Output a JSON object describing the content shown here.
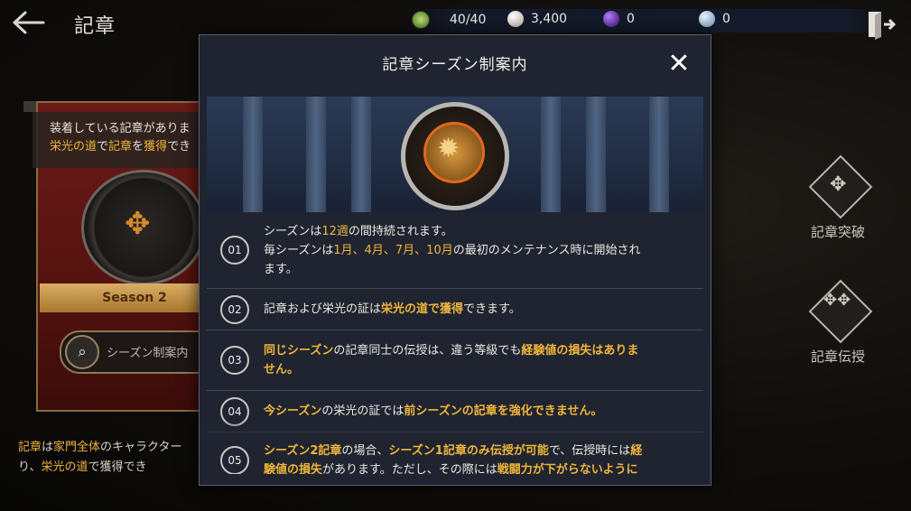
{
  "header": {
    "title": "記章"
  },
  "resources": [
    {
      "value": "40/40",
      "icon": "stamina-icon",
      "color": "#8fbf4a"
    },
    {
      "value": "3,400",
      "icon": "pearl-icon",
      "color": "#d8c9c0"
    },
    {
      "value": "0",
      "icon": "purple-gem-icon",
      "color": "#7a2fb8"
    },
    {
      "value": "0",
      "icon": "silver-coin-icon",
      "color": "#9fc4e8"
    }
  ],
  "left_panel": {
    "equip_text_1": "装着している記章がありま",
    "equip_text_2a": "栄光の道",
    "equip_text_2b": "で",
    "equip_text_2c": "記章",
    "equip_text_2d": "を",
    "equip_text_2e": "獲得",
    "equip_text_2f": "でき",
    "season_label": "Season 2",
    "season_guide_label": "シーズン制案内",
    "bottom_1a": "記章",
    "bottom_1b": "は",
    "bottom_1c": "家門全体",
    "bottom_1d": "のキャラクター",
    "bottom_2a": "り、",
    "bottom_2b": "栄光の道",
    "bottom_2c": "で獲得でき"
  },
  "right_buttons": {
    "breakthrough_label": "記章突破",
    "transfer_label": "記章伝授"
  },
  "modal": {
    "title": "記章シーズン制案内",
    "items": [
      {
        "num": "01",
        "l1a": "シーズンは",
        "l1b": "12週",
        "l1c": "の間持続されます。",
        "l2a": "毎シーズンは",
        "l2b": "1月、4月、7月、10月",
        "l2c": "の最初のメンテナンス時に開始され",
        "l3": "ます。"
      },
      {
        "num": "02",
        "a": "記章および栄光の証は",
        "b": "栄光の道で獲得",
        "c": "できます。"
      },
      {
        "num": "03",
        "a": "同じシーズン",
        "b": "の記章同士の伝授は、違う等級でも",
        "c": "経験値の損失はありま",
        "d": "せん。"
      },
      {
        "num": "04",
        "a": "今シーズン",
        "b": "の栄光の証では",
        "c": "前シーズンの記章を強化できません。"
      },
      {
        "num": "05",
        "a": "シーズン2記章",
        "b": "の場合、",
        "c": "シーズン1記章のみ伝授が可能",
        "d": "で、伝授時には",
        "e": "経",
        "f": "験値の損失",
        "g": "があります。ただし、その際には",
        "h": "戦闘力が下がらないように"
      }
    ]
  },
  "colors": {
    "accent_gold": "#f0b53a",
    "modal_bg": "#1f2430"
  }
}
